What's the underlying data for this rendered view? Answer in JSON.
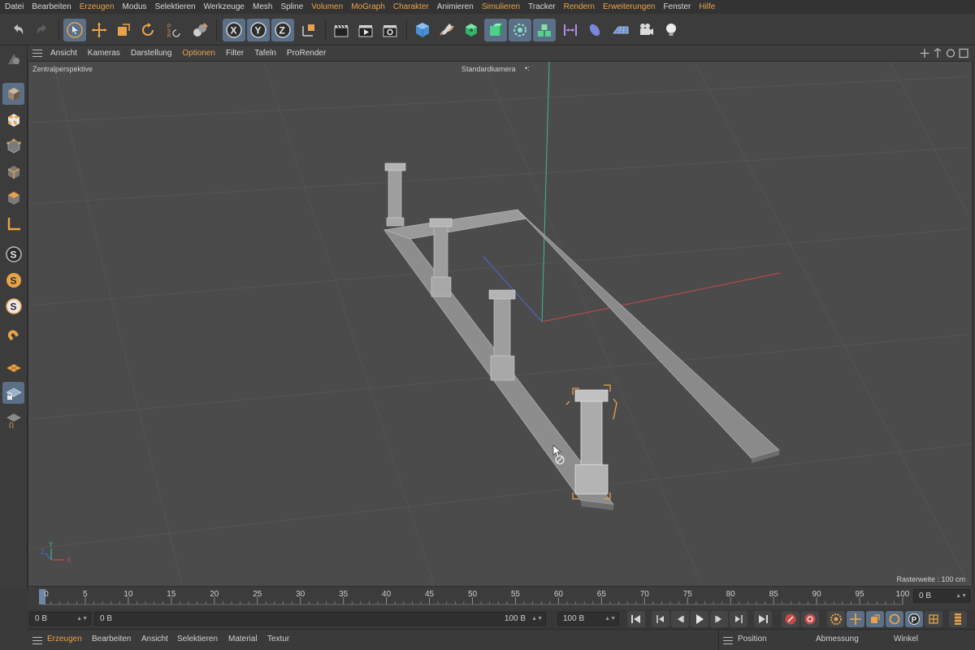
{
  "menubar": {
    "items": [
      {
        "label": "Datei",
        "color": "default"
      },
      {
        "label": "Bearbeiten",
        "color": "default"
      },
      {
        "label": "Erzeugen",
        "color": "orange"
      },
      {
        "label": "Modus",
        "color": "default"
      },
      {
        "label": "Selektieren",
        "color": "default"
      },
      {
        "label": "Werkzeuge",
        "color": "default"
      },
      {
        "label": "Mesh",
        "color": "default"
      },
      {
        "label": "Spline",
        "color": "default"
      },
      {
        "label": "Volumen",
        "color": "orange"
      },
      {
        "label": "MoGraph",
        "color": "orange"
      },
      {
        "label": "Charakter",
        "color": "orange"
      },
      {
        "label": "Animieren",
        "color": "default"
      },
      {
        "label": "Simulieren",
        "color": "orange"
      },
      {
        "label": "Tracker",
        "color": "default"
      },
      {
        "label": "Rendern",
        "color": "orange"
      },
      {
        "label": "Erweiterungen",
        "color": "orange"
      },
      {
        "label": "Fenster",
        "color": "default"
      },
      {
        "label": "Hilfe",
        "color": "orange"
      }
    ]
  },
  "toolbar": {
    "axis_x": "X",
    "axis_y": "Y",
    "axis_z": "Z",
    "psr_label": "PSR"
  },
  "viewport_menu": {
    "items": [
      {
        "label": "Ansicht",
        "color": "default"
      },
      {
        "label": "Kameras",
        "color": "default"
      },
      {
        "label": "Darstellung",
        "color": "default"
      },
      {
        "label": "Optionen",
        "color": "orange"
      },
      {
        "label": "Filter",
        "color": "default"
      },
      {
        "label": "Tafeln",
        "color": "default"
      },
      {
        "label": "ProRender",
        "color": "default"
      }
    ]
  },
  "viewport": {
    "projection_label": "Zentralperspektive",
    "camera_label": "Standardkamera",
    "grid_label": "Rasterweite : 100 cm",
    "axis_x": "X",
    "axis_y": "Y",
    "axis_z": "Z"
  },
  "timeline": {
    "ticks": [
      0,
      5,
      10,
      15,
      20,
      25,
      30,
      35,
      40,
      45,
      50,
      55,
      60,
      65,
      70,
      75,
      80,
      85,
      90,
      95,
      100
    ],
    "current_frame": 0,
    "end_field": "0 B"
  },
  "transport": {
    "start_field": "0 B",
    "current_field": "0 B",
    "range_end": "100 B",
    "end_field": "100 B"
  },
  "bottombar": {
    "items": [
      {
        "label": "Erzeugen",
        "color": "orange"
      },
      {
        "label": "Bearbeiten",
        "color": "default"
      },
      {
        "label": "Ansicht",
        "color": "default"
      },
      {
        "label": "Selektieren",
        "color": "default"
      },
      {
        "label": "Material",
        "color": "default"
      },
      {
        "label": "Textur",
        "color": "default"
      }
    ],
    "coord_headers": [
      "Position",
      "Abmessung",
      "Winkel"
    ]
  },
  "colors": {
    "accent_orange": "#e8a34a",
    "selected_blue": "#5b6f87",
    "axis_x_red": "#c74a4a",
    "axis_y_green": "#3fb88a",
    "axis_z_blue": "#4a6bd0"
  }
}
